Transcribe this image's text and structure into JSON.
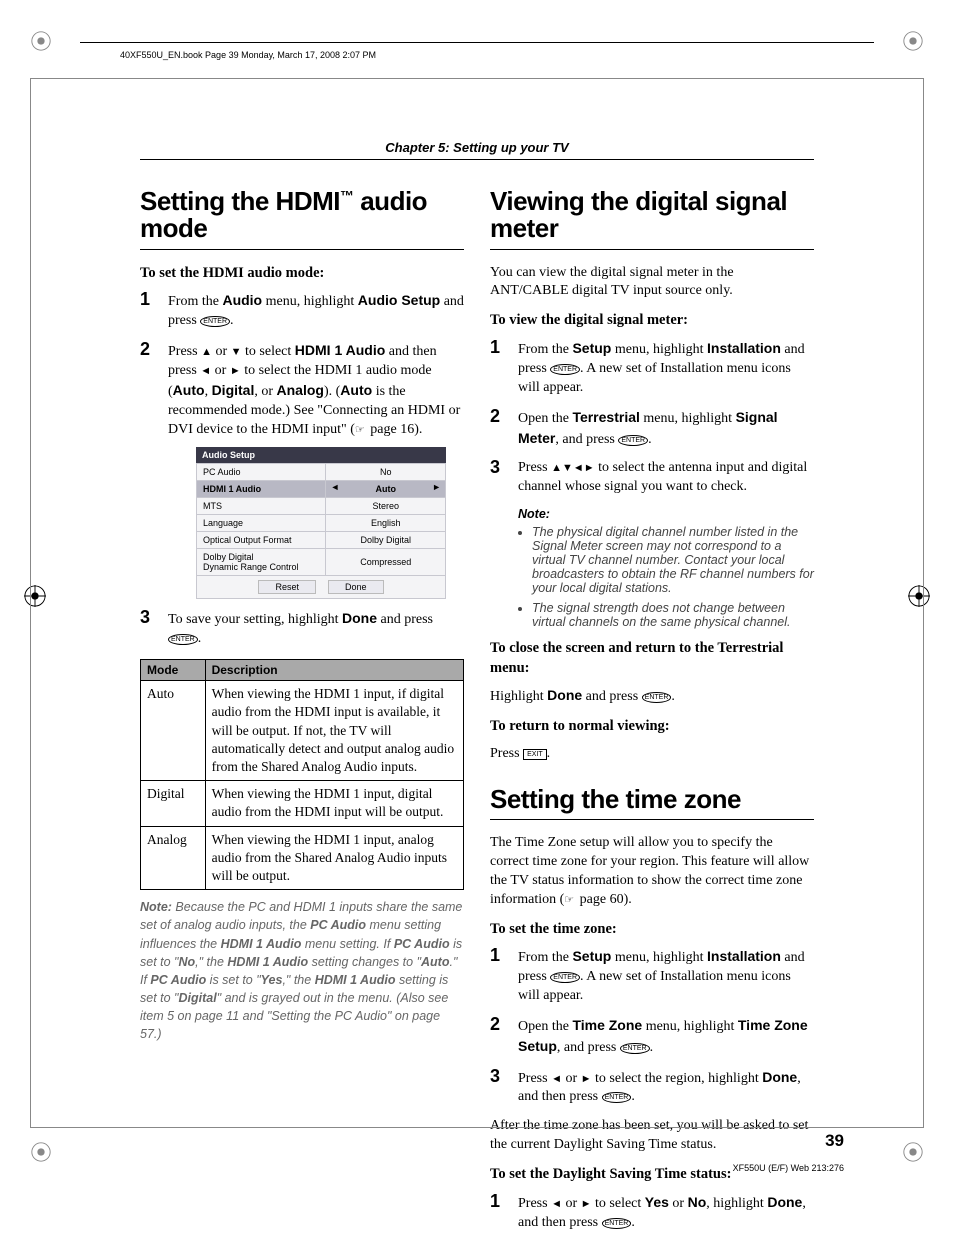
{
  "meta": {
    "book_tag": "40XF550U_EN.book  Page 39  Monday, March 17, 2008  2:07 PM",
    "chapter": "Chapter 5: Setting up your TV",
    "page_number": "39",
    "footer": "XF550U (E/F) Web 213:276"
  },
  "left": {
    "heading_pre": "Setting the HDMI",
    "heading_tm": "™",
    "heading_post": " audio mode",
    "subhead": "To set the HDMI audio mode:",
    "step1_a": "From the ",
    "step1_b": "Audio",
    "step1_c": " menu, highlight ",
    "step1_d": "Audio Setup",
    "step1_e": " and press ",
    "step2_a": "Press ",
    "step2_b": " or ",
    "step2_c": " to select ",
    "step2_d": "HDMI 1 Audio",
    "step2_e": " and then press ",
    "step2_f": " or ",
    "step2_g": " to select the HDMI 1 audio mode (",
    "step2_h": "Auto",
    "step2_i": ", ",
    "step2_j": "Digital",
    "step2_k": ", or ",
    "step2_l": "Analog",
    "step2_m": "). (",
    "step2_n": "Auto",
    "step2_o": " is the recommended mode.) See \"Connecting an HDMI or DVI device to the HDMI input\" (",
    "step2_p": " page 16).",
    "menu": {
      "title": "Audio Setup",
      "rows": [
        {
          "label": "PC Audio",
          "value": "No"
        },
        {
          "label": "HDMI 1 Audio",
          "value": "Auto"
        },
        {
          "label": "MTS",
          "value": "Stereo"
        },
        {
          "label": "Language",
          "value": "English"
        },
        {
          "label": "Optical Output Format",
          "value": "Dolby Digital"
        },
        {
          "label": "Dolby Digital\nDynamic Range Control",
          "value": "Compressed"
        }
      ],
      "btn_reset": "Reset",
      "btn_done": "Done"
    },
    "step3_a": "To save your setting, highlight ",
    "step3_b": "Done",
    "step3_c": " and press ",
    "table": {
      "h1": "Mode",
      "h2": "Description",
      "r1m": "Auto",
      "r1d": "When viewing the HDMI 1 input, if digital audio from the HDMI input is available, it will be output. If not, the TV will automatically detect and output analog audio from the Shared Analog Audio inputs.",
      "r2m": "Digital",
      "r2d": "When viewing the HDMI 1 input, digital audio from the HDMI input will be output.",
      "r3m": "Analog",
      "r3d": "When viewing the HDMI 1 input, analog audio from the Shared Analog Audio inputs will be output."
    },
    "note_label": "Note:",
    "note_a": " Because the PC and HDMI 1 inputs share the same set of analog audio inputs, the ",
    "note_b": "PC Audio",
    "note_c": " menu setting influences the ",
    "note_d": "HDMI 1 Audio",
    "note_e": " menu setting. If ",
    "note_f": "PC Audio",
    "note_g": " is set to \"",
    "note_h": "No",
    "note_i": ",\" the ",
    "note_j": "HDMI 1 Audio",
    "note_k": " setting changes to \"",
    "note_l": "Auto",
    "note_m": ".\" If ",
    "note_n": "PC Audio",
    "note_o": " is set to \"",
    "note_p": "Yes",
    "note_q": ",\" the ",
    "note_r": "HDMI 1 Audio",
    "note_s": " setting is set to \"",
    "note_t": "Digital",
    "note_u": "\" and is grayed out in the menu. (Also see item 5 on page 11 and \"Setting the PC Audio\" on page 57.)"
  },
  "right": {
    "h_signal": "Viewing the digital signal meter",
    "sig_intro": "You can view the digital signal meter in the ANT/CABLE digital TV input source only.",
    "sig_sub": "To view the digital signal meter:",
    "sig1_a": "From the ",
    "sig1_b": "Setup",
    "sig1_c": " menu, highlight ",
    "sig1_d": "Installation",
    "sig1_e": " and press ",
    "sig1_f": ". A new set of Installation menu icons will appear.",
    "sig2_a": "Open the ",
    "sig2_b": "Terrestrial",
    "sig2_c": " menu, highlight ",
    "sig2_d": "Signal Meter",
    "sig2_e": ", and press ",
    "sig3_a": "Press ",
    "sig3_b": " to select the antenna input and digital channel whose signal you want to check.",
    "sig_note_head": "Note:",
    "sig_note1": "The physical digital channel number listed in the Signal Meter screen may not correspond to a virtual TV channel number. Contact your local broadcasters to obtain the RF channel numbers for your local digital stations.",
    "sig_note2": "The signal strength does not change between virtual channels on the same physical channel.",
    "sig_close_head": "To close the screen and return to the Terrestrial menu:",
    "sig_close_a": "Highlight ",
    "sig_close_b": "Done",
    "sig_close_c": " and press ",
    "sig_ret_head": "To return to normal viewing:",
    "sig_ret_a": "Press ",
    "h_tz": "Setting the time zone",
    "tz_intro_a": "The Time Zone setup will allow you to specify the correct time zone for your region. This feature will allow the TV status information to show the correct time zone information (",
    "tz_intro_b": " page 60).",
    "tz_sub": "To set the time zone:",
    "tz1_a": "From the ",
    "tz1_b": "Setup",
    "tz1_c": " menu, highlight ",
    "tz1_d": "Installation",
    "tz1_e": " and press ",
    "tz1_f": ". A new set of Installation menu icons will appear.",
    "tz2_a": "Open the ",
    "tz2_b": "Time Zone",
    "tz2_c": " menu, highlight ",
    "tz2_d": "Time Zone Setup",
    "tz2_e": ", and press ",
    "tz3_a": "Press ",
    "tz3_b": " or ",
    "tz3_c": " to select the region, highlight ",
    "tz3_d": "Done",
    "tz3_e": ", and then press ",
    "tz_after": "After the time zone has been set, you will be asked to set the current Daylight Saving Time status.",
    "dst_sub": "To set the Daylight Saving Time status:",
    "dst1_a": "Press ",
    "dst1_b": " or ",
    "dst1_c": " to select ",
    "dst1_d": "Yes",
    "dst1_e": " or ",
    "dst1_f": "No",
    "dst1_g": ", highlight ",
    "dst1_h": "Done",
    "dst1_i": ", and then press "
  }
}
